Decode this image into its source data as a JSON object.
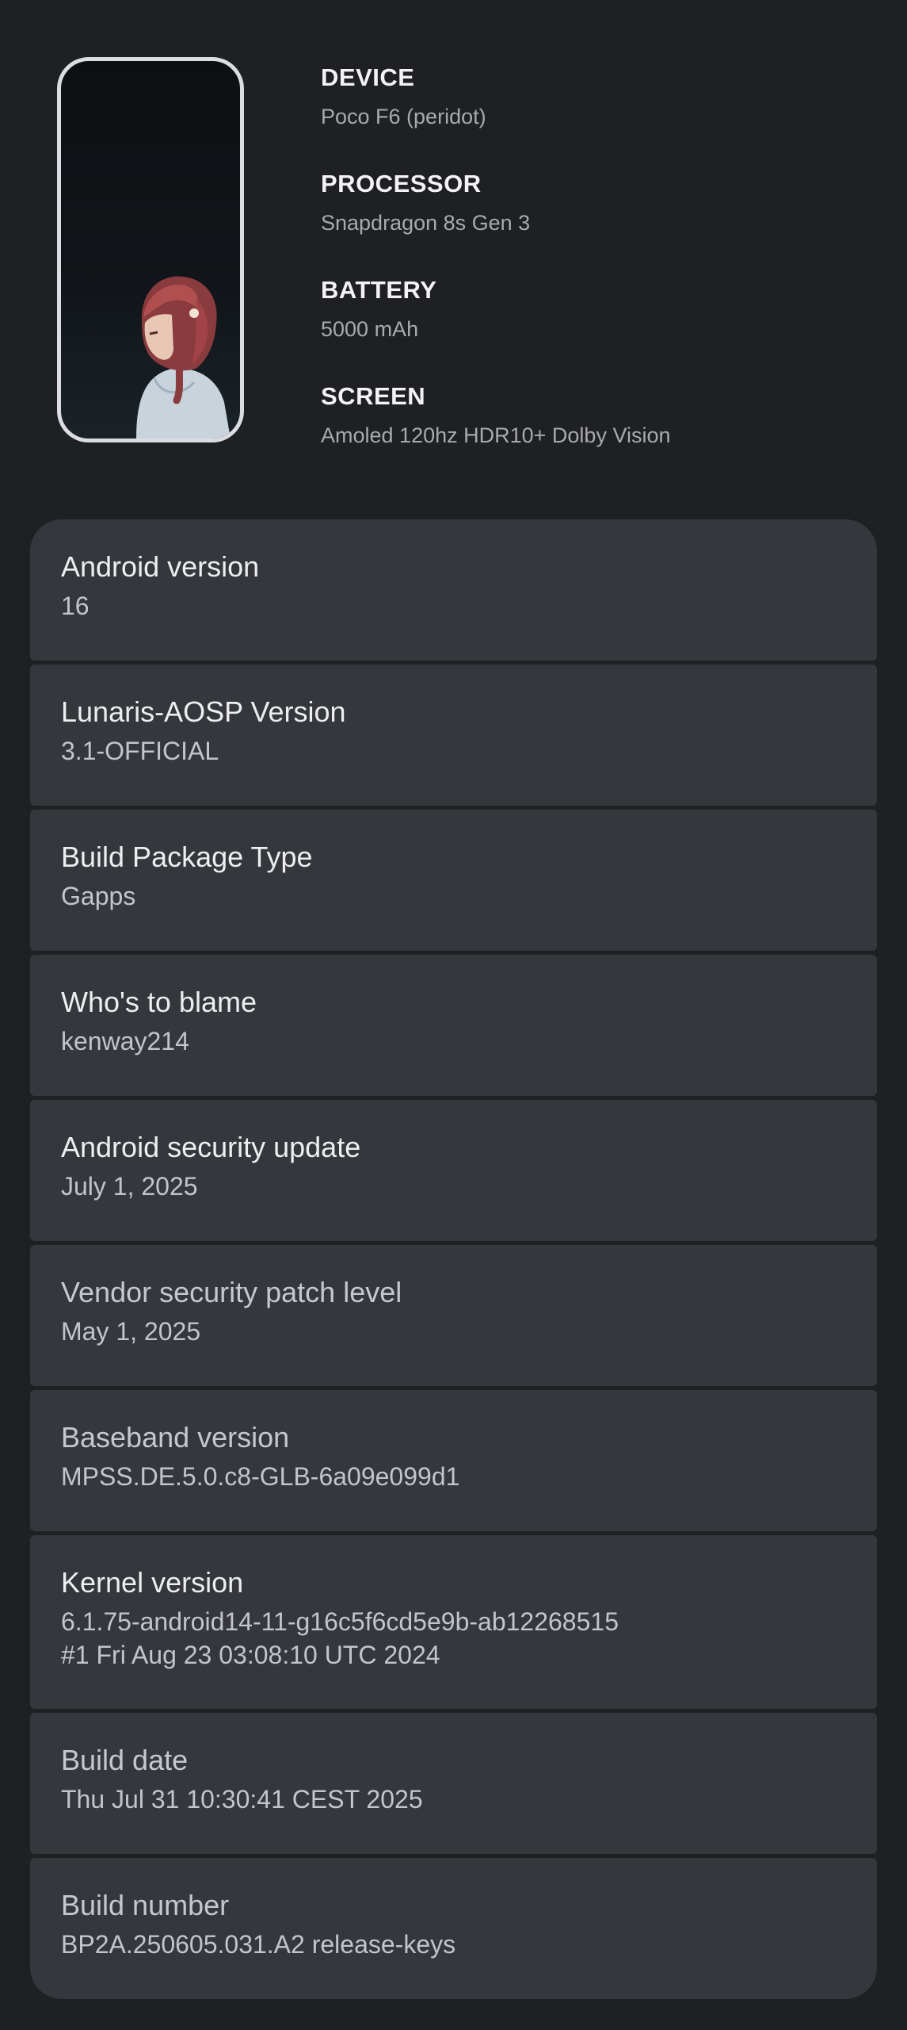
{
  "header": {
    "specs": [
      {
        "label": "DEVICE",
        "value": "Poco F6 (peridot)"
      },
      {
        "label": "PROCESSOR",
        "value": "Snapdragon 8s Gen 3"
      },
      {
        "label": "BATTERY",
        "value": "5000 mAh"
      },
      {
        "label": "SCREEN",
        "value": "Amoled 120hz HDR10+ Dolby Vision"
      }
    ]
  },
  "items": [
    {
      "title": "Android version",
      "value": "16"
    },
    {
      "title": "Lunaris-AOSP Version",
      "value": "3.1-OFFICIAL"
    },
    {
      "title": "Build Package Type",
      "value": "Gapps"
    },
    {
      "title": "Who's to blame",
      "value": "kenway214"
    },
    {
      "title": "Android security update",
      "value": "July 1, 2025"
    },
    {
      "title": "Vendor security patch level",
      "value": "May 1, 2025"
    },
    {
      "title": "Baseband version",
      "value": "MPSS.DE.5.0.c8-GLB-6a09e099d1"
    },
    {
      "title": "Kernel version",
      "value": "6.1.75-android14-11-g16c5f6cd5e9b-ab12268515\n#1 Fri Aug 23 03:08:10 UTC 2024"
    },
    {
      "title": "Build date",
      "value": "Thu Jul 31 10:30:41 CEST 2025"
    },
    {
      "title": "Build number",
      "value": "BP2A.250605.031.A2 release-keys"
    }
  ],
  "colors": {
    "background": "#1e2024",
    "card": "#36373c",
    "phone_frame": "#dcdde3"
  }
}
